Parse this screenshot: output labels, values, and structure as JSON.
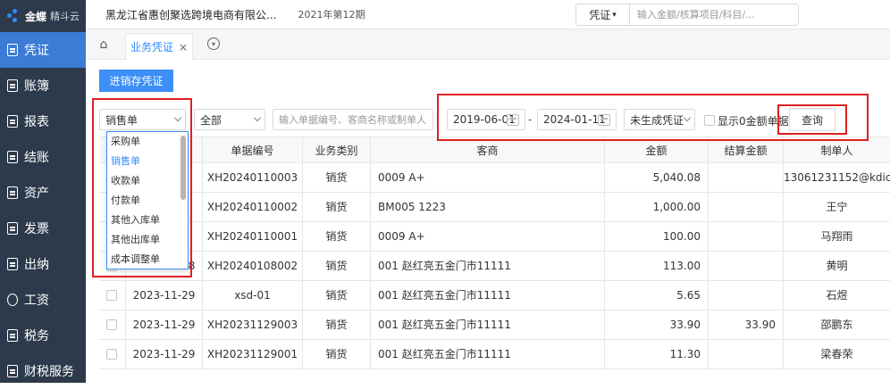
{
  "app": {
    "brand": "金蝶",
    "brand_sub": "精斗云",
    "company": "黑龙江省惠创聚选跨境电商有限公...",
    "period": "2021年第12期"
  },
  "search": {
    "type": "凭证",
    "placeholder": "输入金额/核算项目/科目/..."
  },
  "sidebar": {
    "items": [
      {
        "label": "凭证"
      },
      {
        "label": "账簿"
      },
      {
        "label": "报表"
      },
      {
        "label": "结账"
      },
      {
        "label": "资产"
      },
      {
        "label": "发票"
      },
      {
        "label": "出纳"
      },
      {
        "label": "工资"
      },
      {
        "label": "税务"
      },
      {
        "label": "财税服务"
      }
    ]
  },
  "tabs": {
    "active": "业务凭证",
    "close": "×"
  },
  "toolbar": {
    "primary": "进销存凭证"
  },
  "filters": {
    "doc_type": "销售单",
    "category": "全部",
    "keyword_placeholder": "输入单据编号、客商名称或制单人",
    "date_from": "2019-06-01",
    "date_sep": "-",
    "date_to": "2024-01-11",
    "status": "未生成凭证",
    "show_zero": "显示0金额单据",
    "query": "查询"
  },
  "dropdown": {
    "options": [
      "采购单",
      "销售单",
      "收款单",
      "付款单",
      "其他入库单",
      "其他出库单",
      "成本调整单"
    ]
  },
  "table": {
    "headers": [
      "单据编号",
      "业务类别",
      "客商",
      "金额",
      "结算金额",
      "制单人"
    ],
    "rows": [
      {
        "date": "",
        "no": "XH20240110003",
        "cat": "销货",
        "party": "0009 A+",
        "amount": "5,040.08",
        "settle": "",
        "maker": "13061231152@kdic"
      },
      {
        "date": "",
        "no": "XH20240110002",
        "cat": "销货",
        "party": "BM005 1223",
        "amount": "1,000.00",
        "settle": "",
        "maker": "王宁"
      },
      {
        "date": "",
        "no": "XH20240110001",
        "cat": "销货",
        "party": "0009 A+",
        "amount": "100.00",
        "settle": "",
        "maker": "马翔雨"
      },
      {
        "date": "2024-01-08",
        "no": "XH20240108002",
        "cat": "销货",
        "party": "001 赵红亮五金门市11111",
        "amount": "113.00",
        "settle": "",
        "maker": "黄明"
      },
      {
        "date": "2023-11-29",
        "no": "xsd-01",
        "cat": "销货",
        "party": "001 赵红亮五金门市11111",
        "amount": "5.65",
        "settle": "",
        "maker": "石煜"
      },
      {
        "date": "2023-11-29",
        "no": "XH20231129003",
        "cat": "销货",
        "party": "001 赵红亮五金门市11111",
        "amount": "33.90",
        "settle": "33.90",
        "maker": "邵鹏东"
      },
      {
        "date": "2023-11-29",
        "no": "XH20231129001",
        "cat": "销货",
        "party": "001 赵红亮五金门市11111",
        "amount": "11.30",
        "settle": "",
        "maker": "梁春荣"
      }
    ]
  }
}
